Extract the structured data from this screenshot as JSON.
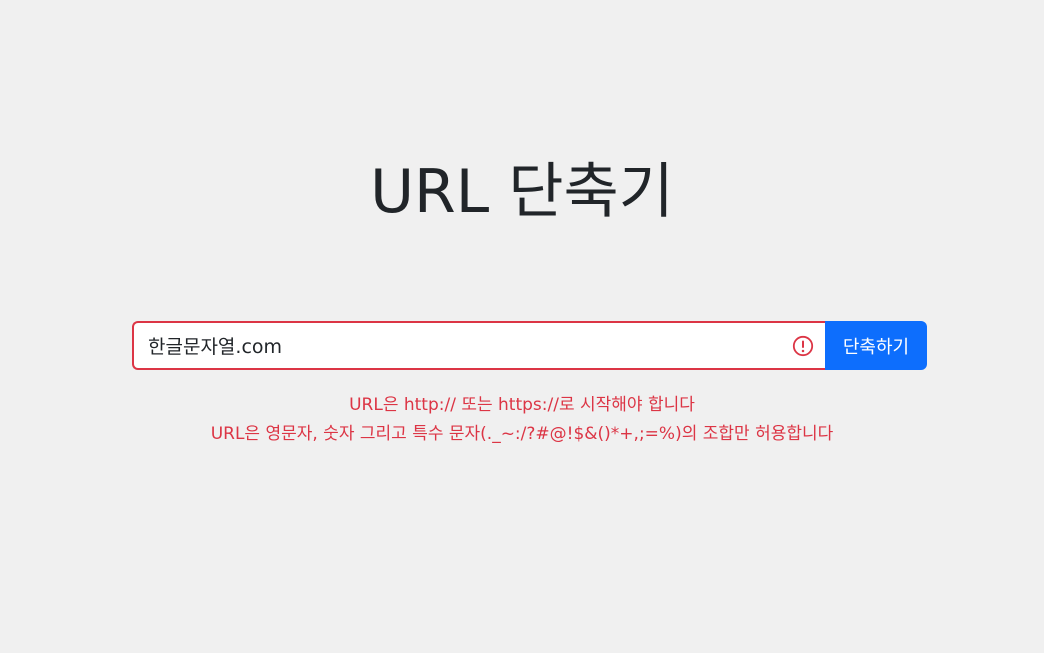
{
  "header": {
    "title": "URL 단축기"
  },
  "form": {
    "input_value": "한글문자열.com",
    "input_state": "invalid",
    "submit_label": "단축하기"
  },
  "errors": [
    "URL은 http:// 또는 https://로 시작해야 합니다",
    "URL은 영문자, 숫자 그리고 특수 문자(._~:/?#@!$&()*+,;=%)의 조합만 허용합니다"
  ],
  "colors": {
    "background": "#f0f0f0",
    "primary": "#0d6efd",
    "danger": "#dc3545",
    "text": "#212529"
  },
  "icons": {
    "invalid": "exclamation-circle-icon"
  }
}
